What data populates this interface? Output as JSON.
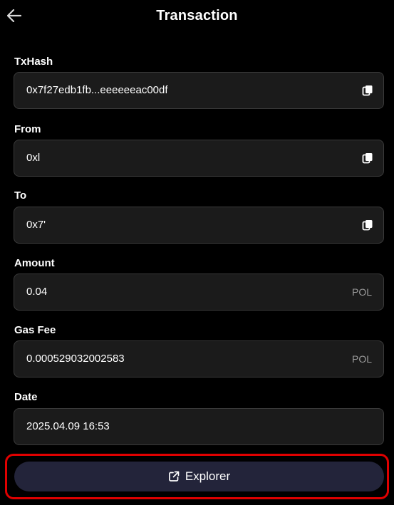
{
  "header": {
    "title": "Transaction"
  },
  "fields": {
    "txhash": {
      "label": "TxHash",
      "value": "0x7f27edb1fb...eeeeeeac00df"
    },
    "from": {
      "label": "From",
      "value": "0xl"
    },
    "to": {
      "label": "To",
      "value": "0x7'"
    },
    "amount": {
      "label": "Amount",
      "value": "0.04",
      "unit": "POL"
    },
    "gas_fee": {
      "label": "Gas Fee",
      "value": "0.000529032002583",
      "unit": "POL"
    },
    "date": {
      "label": "Date",
      "value": "2025.04.09 16:53"
    }
  },
  "explorer_button": {
    "label": "Explorer"
  },
  "icons": {
    "back": "arrow-left-icon",
    "copy": "copy-icon",
    "explorer": "external-link-icon"
  },
  "colors": {
    "background": "#000000",
    "field_background": "#1b1b1b",
    "field_border": "#3a3a3a",
    "button_background": "#23243a",
    "highlight": "#e00000",
    "unit_text": "#9a9a9a"
  }
}
